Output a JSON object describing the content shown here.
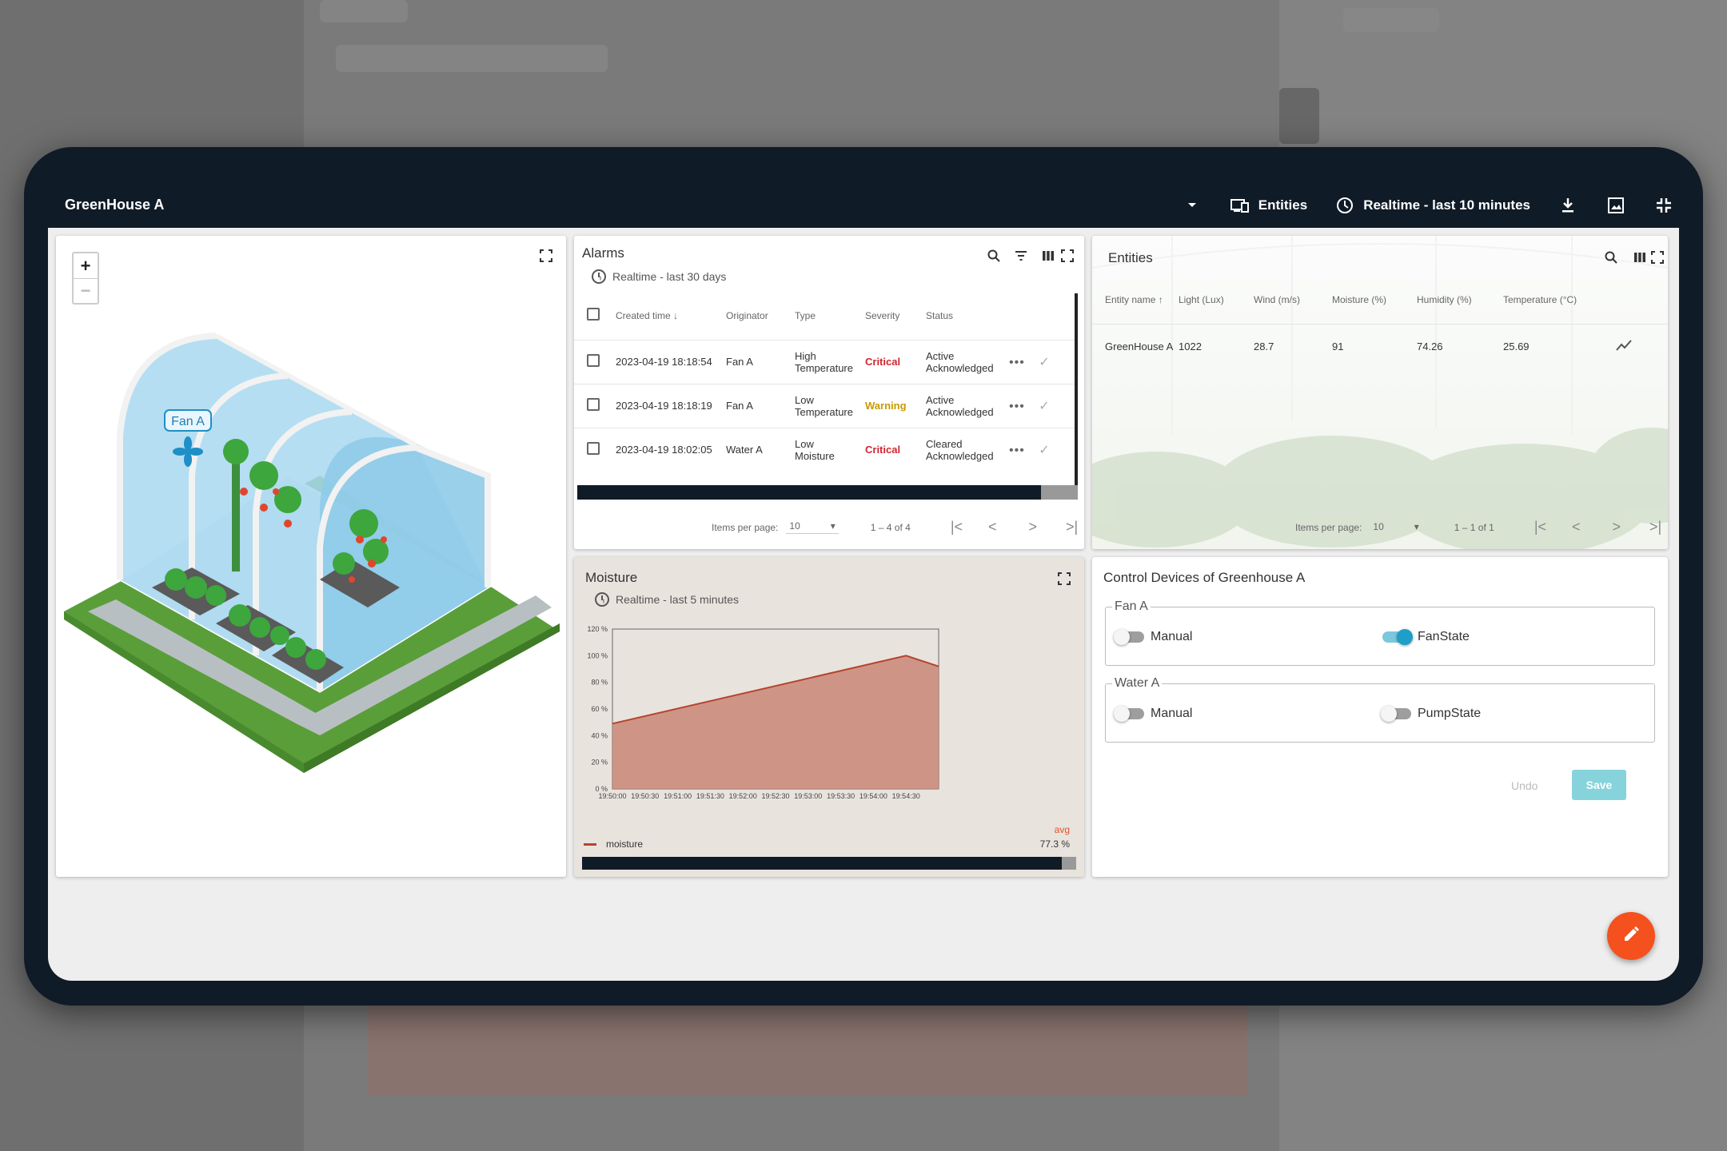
{
  "dashboard": {
    "title": "GreenHouse A",
    "entities_label": "Entities",
    "timewindow_label": "Realtime - last 10 minutes"
  },
  "map": {
    "fan_label": "Fan A",
    "zoom_in": "+",
    "zoom_out": "−"
  },
  "alarms": {
    "title": "Alarms",
    "timewindow": "Realtime - last 30 days",
    "columns": [
      "Created time",
      "Originator",
      "Type",
      "Severity",
      "Status"
    ],
    "rows": [
      {
        "created": "2023-04-19 18:18:54",
        "originator": "Fan A",
        "type1": "High",
        "type2": "Temperature",
        "severity": "Critical",
        "status1": "Active",
        "status2": "Acknowledged"
      },
      {
        "created": "2023-04-19 18:18:19",
        "originator": "Fan A",
        "type1": "Low",
        "type2": "Temperature",
        "severity": "Warning",
        "status1": "Active",
        "status2": "Acknowledged"
      },
      {
        "created": "2023-04-19 18:02:05",
        "originator": "Water A",
        "type1": "Low",
        "type2": "Moisture",
        "severity": "Critical",
        "status1": "Cleared",
        "status2": "Acknowledged"
      }
    ],
    "items_per_page_label": "Items per page:",
    "items_per_page": "10",
    "range": "1 – 4 of 4"
  },
  "entities": {
    "title": "Entities",
    "columns": [
      "Entity name",
      "Light (Lux)",
      "Wind (m/s)",
      "Moisture (%)",
      "Humidity (%)",
      "Temperature (°C)"
    ],
    "rows": [
      {
        "name": "GreenHouse A",
        "light": "1022",
        "wind": "28.7",
        "moisture": "91",
        "humidity": "74.26",
        "temperature": "25.69"
      }
    ],
    "items_per_page_label": "Items per page:",
    "items_per_page": "10",
    "range": "1 – 1 of 1"
  },
  "moisture": {
    "title": "Moisture",
    "timewindow": "Realtime - last 5 minutes",
    "legend_name": "moisture",
    "avg_label": "avg",
    "avg_value": "77.3 %"
  },
  "chart_data": {
    "type": "area",
    "x": [
      "19:50:00",
      "19:50:30",
      "19:51:00",
      "19:51:30",
      "19:52:00",
      "19:52:30",
      "19:53:00",
      "19:53:30",
      "19:54:00",
      "19:54:30"
    ],
    "x_ticks": [
      "19:50:00",
      "19:50:30",
      "19:51:00",
      "19:51:30",
      "19:52:00",
      "19:52:30",
      "19:53:00",
      "19:53:30",
      "19:54:00",
      "19:54:30"
    ],
    "y_ticks": [
      "120 %",
      "100 %",
      "80 %",
      "60 %",
      "40 %",
      "20 %",
      "0 %"
    ],
    "ylim": [
      0,
      120
    ],
    "series": [
      {
        "name": "moisture",
        "x_sec": [
          0,
          270,
          300
        ],
        "values": [
          49,
          100,
          92
        ]
      }
    ],
    "color": "#b5442d",
    "fill": "#c98778"
  },
  "control": {
    "title": "Control Devices of Greenhouse A",
    "groups": [
      {
        "name": "Fan A",
        "left_label": "Manual",
        "right_label": "FanState",
        "left_on": false,
        "right_on": true
      },
      {
        "name": "Water A",
        "left_label": "Manual",
        "right_label": "PumpState",
        "left_on": false,
        "right_on": false
      }
    ],
    "undo_label": "Undo",
    "save_label": "Save"
  }
}
